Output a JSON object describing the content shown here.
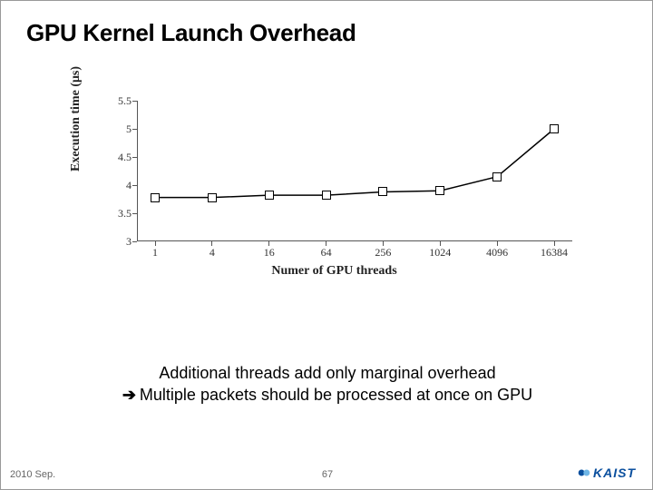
{
  "title": "GPU Kernel Launch Overhead",
  "caption_line1": "Additional threads add only marginal overhead",
  "caption_line2": "Multiple packets should be processed at once on GPU",
  "footer": {
    "date": "2010 Sep.",
    "page": "67",
    "logo_text": "KAIST"
  },
  "chart_data": {
    "type": "line",
    "xlabel": "Numer of GPU threads",
    "ylabel": "Execution time (μs)",
    "x_categories": [
      "1",
      "4",
      "16",
      "64",
      "256",
      "1024",
      "4096",
      "16384"
    ],
    "y_ticks": [
      3,
      3.5,
      4,
      4.5,
      5,
      5.5
    ],
    "ylim": [
      3,
      5.5
    ],
    "values": [
      3.78,
      3.78,
      3.82,
      3.82,
      3.88,
      3.9,
      4.15,
      5.0
    ]
  }
}
